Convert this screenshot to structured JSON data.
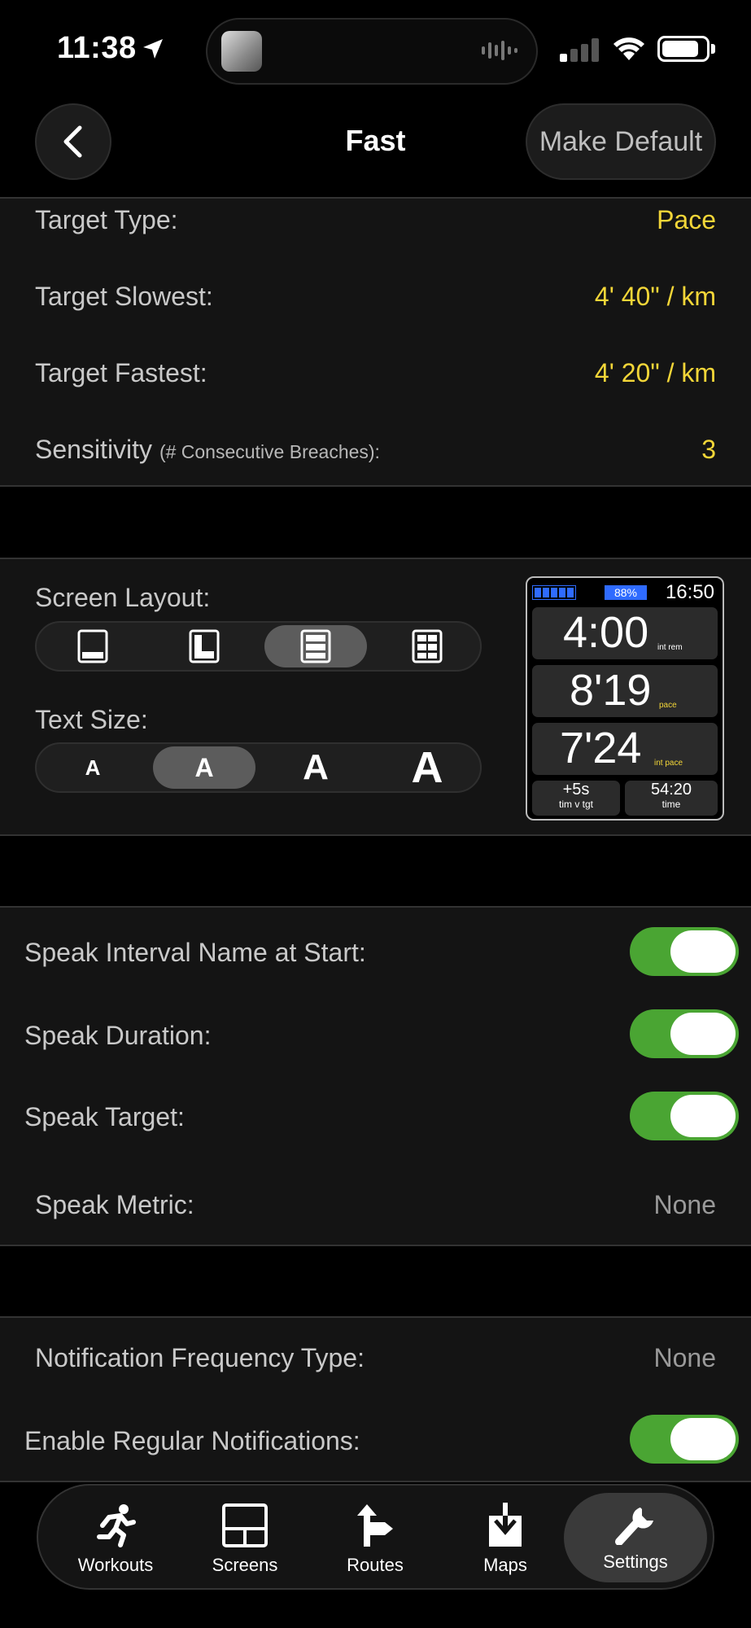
{
  "status_bar": {
    "time": "11:38"
  },
  "nav": {
    "title": "Fast",
    "make_default_label": "Make Default"
  },
  "target": {
    "type_label": "Target Type:",
    "type_value": "Pace",
    "slowest_label": "Target Slowest:",
    "slowest_value": "4' 40\" / km",
    "fastest_label": "Target Fastest:",
    "fastest_value": "4' 20\" / km",
    "sensitivity_label": "Sensitivity",
    "sensitivity_sub": "(# Consecutive Breaches):",
    "sensitivity_value": "3"
  },
  "display": {
    "screen_layout_label": "Screen Layout:",
    "layout_options": [
      "single-field",
      "two-field",
      "three-field",
      "grid"
    ],
    "selected_layout": "three-field",
    "text_size_label": "Text Size:",
    "text_sizes": [
      "A",
      "A",
      "A",
      "A"
    ],
    "selected_text_size": 1
  },
  "watch_preview": {
    "battery_percent": "88%",
    "clock": "16:50",
    "field1_value": "4:00",
    "field1_label": "int rem",
    "field2_value": "8'19",
    "field2_label": "pace",
    "field3_value": "7'24",
    "field3_label": "int pace",
    "bottom_left_value": "+5s",
    "bottom_left_label": "tim v tgt",
    "bottom_right_value": "54:20",
    "bottom_right_label": "time"
  },
  "speech": {
    "interval_name_label": "Speak Interval Name at Start:",
    "interval_name_on": true,
    "duration_label": "Speak Duration:",
    "duration_on": true,
    "target_label": "Speak Target:",
    "target_on": true,
    "metric_label": "Speak Metric:",
    "metric_value": "None"
  },
  "notifications": {
    "frequency_label": "Notification Frequency Type:",
    "frequency_value": "None",
    "regular_label": "Enable Regular Notifications:",
    "regular_on": true
  },
  "tabbar": {
    "items": [
      {
        "label": "Workouts",
        "icon": "runner-icon"
      },
      {
        "label": "Screens",
        "icon": "screens-icon"
      },
      {
        "label": "Routes",
        "icon": "route-sign-icon"
      },
      {
        "label": "Maps",
        "icon": "download-map-icon"
      },
      {
        "label": "Settings",
        "icon": "wrench-icon"
      }
    ],
    "selected": "Settings"
  },
  "colors": {
    "accent_yellow": "#f3d638",
    "toggle_green": "#4aa533",
    "watch_battery_blue": "#2f6bff"
  }
}
